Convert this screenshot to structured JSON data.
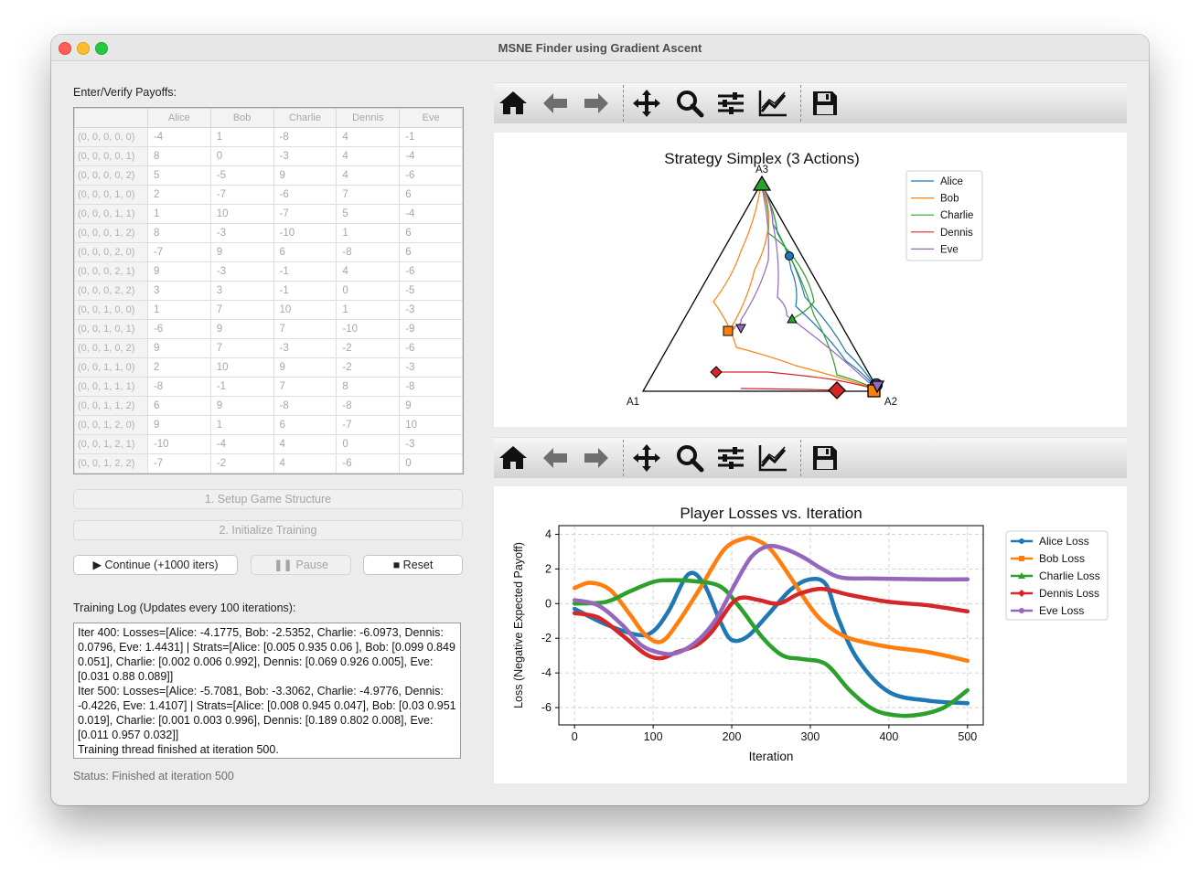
{
  "window": {
    "title": "MSNE Finder using Gradient Ascent"
  },
  "payoffs": {
    "label": "Enter/Verify Payoffs:",
    "columns": [
      "Alice",
      "Bob",
      "Charlie",
      "Dennis",
      "Eve"
    ],
    "rows": [
      {
        "profile": "(0, 0, 0, 0, 0)",
        "values": [
          "-4",
          "1",
          "-8",
          "4",
          "-1"
        ]
      },
      {
        "profile": "(0, 0, 0, 0, 1)",
        "values": [
          "8",
          "0",
          "-3",
          "4",
          "-4"
        ]
      },
      {
        "profile": "(0, 0, 0, 0, 2)",
        "values": [
          "5",
          "-5",
          "9",
          "4",
          "-6"
        ]
      },
      {
        "profile": "(0, 0, 0, 1, 0)",
        "values": [
          "2",
          "-7",
          "-6",
          "7",
          "6"
        ]
      },
      {
        "profile": "(0, 0, 0, 1, 1)",
        "values": [
          "1",
          "10",
          "-7",
          "5",
          "-4"
        ]
      },
      {
        "profile": "(0, 0, 0, 1, 2)",
        "values": [
          "8",
          "-3",
          "-10",
          "1",
          "6"
        ]
      },
      {
        "profile": "(0, 0, 0, 2, 0)",
        "values": [
          "-7",
          "9",
          "6",
          "-8",
          "6"
        ]
      },
      {
        "profile": "(0, 0, 0, 2, 1)",
        "values": [
          "9",
          "-3",
          "-1",
          "4",
          "-6"
        ]
      },
      {
        "profile": "(0, 0, 0, 2, 2)",
        "values": [
          "3",
          "3",
          "-1",
          "0",
          "-5"
        ]
      },
      {
        "profile": "(0, 0, 1, 0, 0)",
        "values": [
          "1",
          "7",
          "10",
          "1",
          "-3"
        ]
      },
      {
        "profile": "(0, 0, 1, 0, 1)",
        "values": [
          "-6",
          "9",
          "7",
          "-10",
          "-9"
        ]
      },
      {
        "profile": "(0, 0, 1, 0, 2)",
        "values": [
          "9",
          "7",
          "-3",
          "-2",
          "-6"
        ]
      },
      {
        "profile": "(0, 0, 1, 1, 0)",
        "values": [
          "2",
          "10",
          "9",
          "-2",
          "-3"
        ]
      },
      {
        "profile": "(0, 0, 1, 1, 1)",
        "values": [
          "-8",
          "-1",
          "7",
          "8",
          "-8"
        ]
      },
      {
        "profile": "(0, 0, 1, 1, 2)",
        "values": [
          "6",
          "9",
          "-8",
          "-8",
          "9"
        ]
      },
      {
        "profile": "(0, 0, 1, 2, 0)",
        "values": [
          "9",
          "1",
          "6",
          "-7",
          "10"
        ]
      },
      {
        "profile": "(0, 0, 1, 2, 1)",
        "values": [
          "-10",
          "-4",
          "4",
          "0",
          "-3"
        ]
      },
      {
        "profile": "(0, 0, 1, 2, 2)",
        "values": [
          "-7",
          "-2",
          "4",
          "-6",
          "0"
        ]
      }
    ]
  },
  "buttons": {
    "setup": "1. Setup Game Structure",
    "init": "2. Initialize Training",
    "continue": "▶ Continue (+1000 iters)",
    "pause": "❚❚ Pause",
    "reset": "■ Reset"
  },
  "log": {
    "label": "Training Log (Updates every 100 iterations):",
    "text": "Iter 400: Losses=[Alice: -4.1775, Bob: -2.5352, Charlie: -6.0973, Dennis: 0.0796, Eve: 1.4431] | Strats=[Alice: [0.005 0.935 0.06 ], Bob: [0.099 0.849 0.051], Charlie: [0.002 0.006 0.992], Dennis: [0.069 0.926 0.005], Eve: [0.031 0.88  0.089]]\nIter 500: Losses=[Alice: -5.7081, Bob: -3.3062, Charlie: -4.9776, Dennis: -0.4226, Eve: 1.4107] | Strats=[Alice: [0.008 0.945 0.047], Bob: [0.03  0.951 0.019], Charlie: [0.001 0.003 0.996], Dennis: [0.189 0.802 0.008], Eve: [0.011 0.957 0.032]]\nTraining thread finished at iteration 500."
  },
  "status": "Status: Finished at iteration 500",
  "toolbar_icons": [
    "home-icon",
    "back-arrow-icon",
    "forward-arrow-icon",
    "pan-icon",
    "zoom-icon",
    "configure-subplots-icon",
    "edit-axes-icon",
    "save-icon"
  ],
  "chart_data": [
    {
      "type": "line",
      "title": "Strategy Simplex (3 Actions)",
      "vertex_labels": [
        "A1",
        "A2",
        "A3"
      ],
      "series": [
        {
          "name": "Alice",
          "color": "#1f77b4"
        },
        {
          "name": "Bob",
          "color": "#ff7f0e"
        },
        {
          "name": "Charlie",
          "color": "#2ca02c"
        },
        {
          "name": "Dennis",
          "color": "#d62728"
        },
        {
          "name": "Eve",
          "color": "#9467bd"
        }
      ],
      "legend": "top-right"
    },
    {
      "type": "line",
      "title": "Player Losses vs. Iteration",
      "xlabel": "Iteration",
      "ylabel": "Loss (Negative Expected Payoff)",
      "xlim": [
        -20,
        520
      ],
      "ylim": [
        -7,
        4.5
      ],
      "xticks": [
        0,
        100,
        200,
        300,
        400,
        500
      ],
      "yticks": [
        4,
        2,
        0,
        -2,
        -4,
        -6
      ],
      "grid": true,
      "legend": "outside-right",
      "series": [
        {
          "name": "Alice Loss",
          "color": "#1f77b4",
          "x": [
            0,
            40,
            80,
            100,
            120,
            145,
            165,
            185,
            200,
            220,
            245,
            275,
            300,
            320,
            335,
            360,
            400,
            450,
            500
          ],
          "y": [
            -0.3,
            -1.2,
            -1.8,
            -1.6,
            -0.4,
            1.7,
            1.1,
            -1.0,
            -2.1,
            -1.9,
            -0.7,
            0.8,
            1.4,
            1.1,
            -0.8,
            -3.2,
            -5.1,
            -5.6,
            -5.75
          ]
        },
        {
          "name": "Bob Loss",
          "color": "#ff7f0e",
          "x": [
            0,
            20,
            45,
            70,
            90,
            110,
            130,
            160,
            190,
            215,
            230,
            250,
            275,
            300,
            320,
            350,
            400,
            450,
            500
          ],
          "y": [
            0.9,
            1.2,
            0.8,
            -0.6,
            -1.8,
            -2.2,
            -1.2,
            0.9,
            3.1,
            3.75,
            3.7,
            3.1,
            1.5,
            -0.2,
            -1.2,
            -2.0,
            -2.5,
            -2.8,
            -3.3
          ]
        },
        {
          "name": "Charlie Loss",
          "color": "#2ca02c",
          "x": [
            0,
            40,
            70,
            100,
            120,
            150,
            185,
            210,
            240,
            265,
            290,
            320,
            350,
            380,
            410,
            440,
            470,
            500
          ],
          "y": [
            0.0,
            0.1,
            0.7,
            1.25,
            1.35,
            1.3,
            1.0,
            -0.2,
            -2.0,
            -3.0,
            -3.2,
            -3.5,
            -5.0,
            -6.1,
            -6.45,
            -6.4,
            -6.0,
            -5.0
          ]
        },
        {
          "name": "Dennis Loss",
          "color": "#d62728",
          "x": [
            0,
            30,
            60,
            90,
            110,
            130,
            155,
            175,
            200,
            215,
            235,
            260,
            285,
            315,
            350,
            400,
            450,
            500
          ],
          "y": [
            -0.55,
            -0.8,
            -1.8,
            -2.9,
            -3.15,
            -2.8,
            -2.4,
            -1.6,
            0.0,
            0.35,
            0.2,
            0.0,
            0.55,
            0.85,
            0.5,
            0.1,
            -0.1,
            -0.45
          ]
        },
        {
          "name": "Eve Loss",
          "color": "#9467bd",
          "x": [
            0,
            30,
            60,
            85,
            110,
            130,
            155,
            180,
            205,
            225,
            245,
            265,
            290,
            315,
            340,
            380,
            450,
            500
          ],
          "y": [
            0.2,
            -0.1,
            -1.2,
            -2.4,
            -2.85,
            -2.85,
            -2.2,
            -0.9,
            1.2,
            2.7,
            3.3,
            3.2,
            2.7,
            2.0,
            1.5,
            1.45,
            1.4,
            1.4
          ]
        }
      ]
    }
  ]
}
